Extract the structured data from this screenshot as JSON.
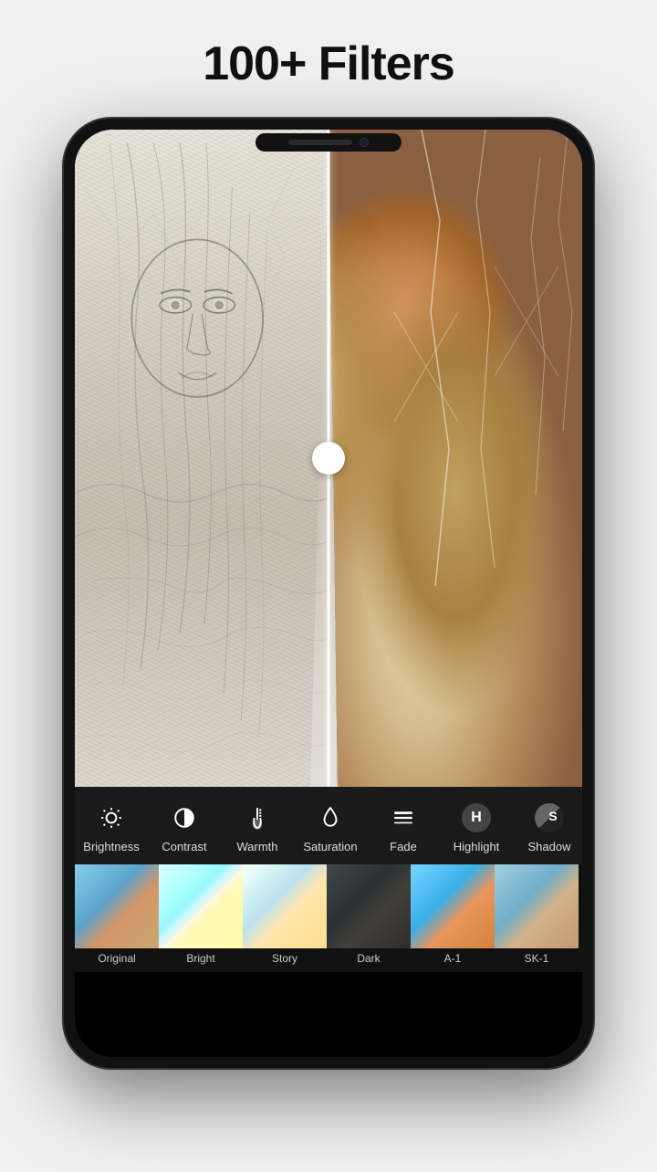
{
  "header": {
    "title": "100+ Filters"
  },
  "toolbar": {
    "tools": [
      {
        "id": "brightness",
        "label": "Brightness",
        "icon": "sun"
      },
      {
        "id": "contrast",
        "label": "Contrast",
        "icon": "contrast"
      },
      {
        "id": "warmth",
        "label": "Warmth",
        "icon": "thermometer"
      },
      {
        "id": "saturation",
        "label": "Saturation",
        "icon": "drop"
      },
      {
        "id": "fade",
        "label": "Fade",
        "icon": "lines"
      },
      {
        "id": "highlight",
        "label": "Highlight",
        "icon": "H"
      },
      {
        "id": "shadow",
        "label": "Shadow",
        "icon": "S"
      }
    ]
  },
  "filters": [
    {
      "id": "original",
      "label": "Original",
      "thumb": "original",
      "selected": false
    },
    {
      "id": "bright",
      "label": "Bright",
      "thumb": "bright",
      "selected": false
    },
    {
      "id": "story",
      "label": "Story",
      "thumb": "story",
      "selected": false
    },
    {
      "id": "dark",
      "label": "Dark",
      "thumb": "dark",
      "selected": false
    },
    {
      "id": "a1",
      "label": "A-1",
      "thumb": "a1",
      "selected": false
    },
    {
      "id": "sk1",
      "label": "SK-1",
      "thumb": "sk1",
      "selected": false
    }
  ]
}
